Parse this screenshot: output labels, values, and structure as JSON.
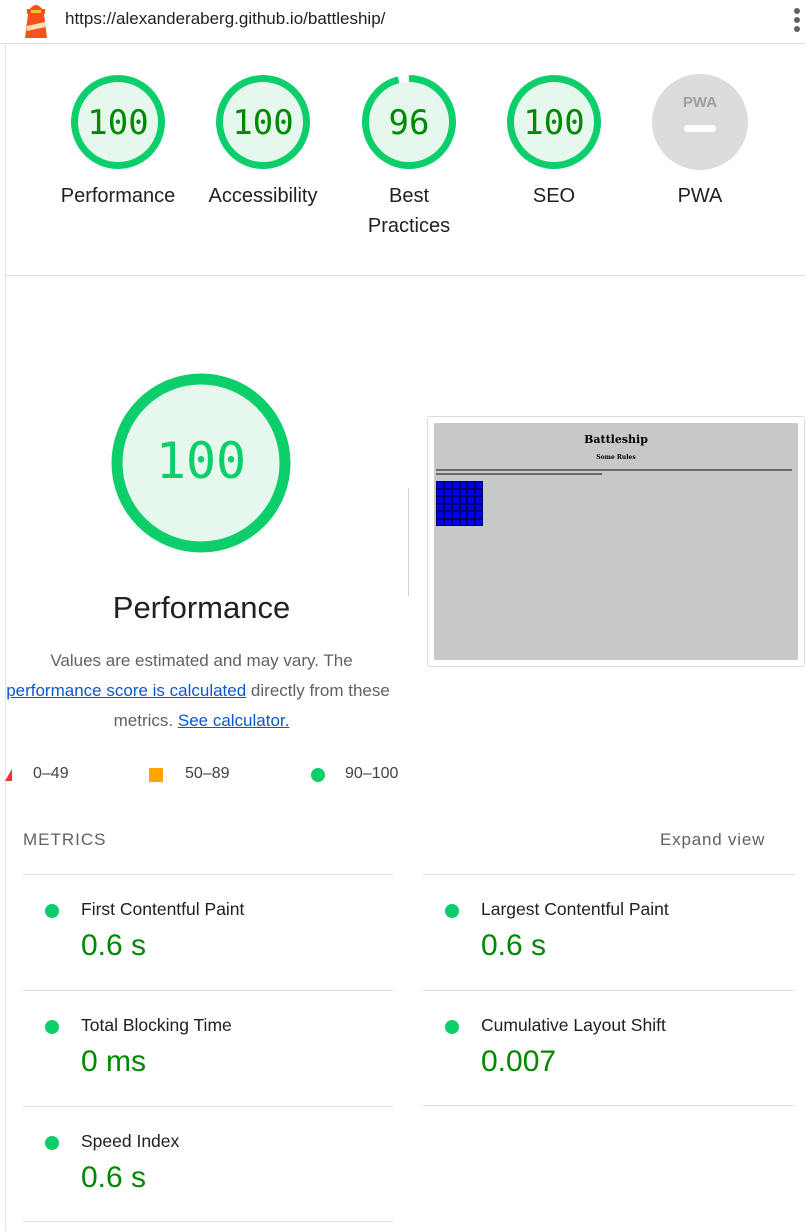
{
  "header": {
    "url": "https://alexanderaberg.github.io/battleship/"
  },
  "colors": {
    "pass": "#0cce6b",
    "pass_text": "#008800",
    "average": "#ffa400",
    "fail": "#e53935",
    "na": "#dcdcdc"
  },
  "categories": [
    {
      "score": "100",
      "score_fraction": 1.0,
      "label": "Performance"
    },
    {
      "score": "100",
      "score_fraction": 1.0,
      "label": "Accessibility"
    },
    {
      "score": "96",
      "score_fraction": 0.96,
      "label_line1": "Best",
      "label_line2": "Practices"
    },
    {
      "score": "100",
      "score_fraction": 1.0,
      "label": "SEO"
    },
    {
      "badge": "PWA",
      "label": "PWA"
    }
  ],
  "performance": {
    "score": "100",
    "title": "Performance",
    "desc_line1": "Values are estimated and may vary. The",
    "desc_link1": "performance score is calculated",
    "desc_line2_rest": " directly from these",
    "desc_line3": "metrics.",
    "desc_link2": "See calculator."
  },
  "screenshot": {
    "title": "Battleship",
    "subtitle": "Some Rules"
  },
  "legend": {
    "fail": "0–49",
    "average": "50–89",
    "pass": "90–100"
  },
  "metrics": {
    "header": "METRICS",
    "expand": "Expand view",
    "items": [
      {
        "title": "First Contentful Paint",
        "value": "0.6 s"
      },
      {
        "title": "Largest Contentful Paint",
        "value": "0.6 s"
      },
      {
        "title": "Total Blocking Time",
        "value": "0 ms"
      },
      {
        "title": "Cumulative Layout Shift",
        "value": "0.007"
      },
      {
        "title": "Speed Index",
        "value": "0.6 s"
      }
    ]
  }
}
